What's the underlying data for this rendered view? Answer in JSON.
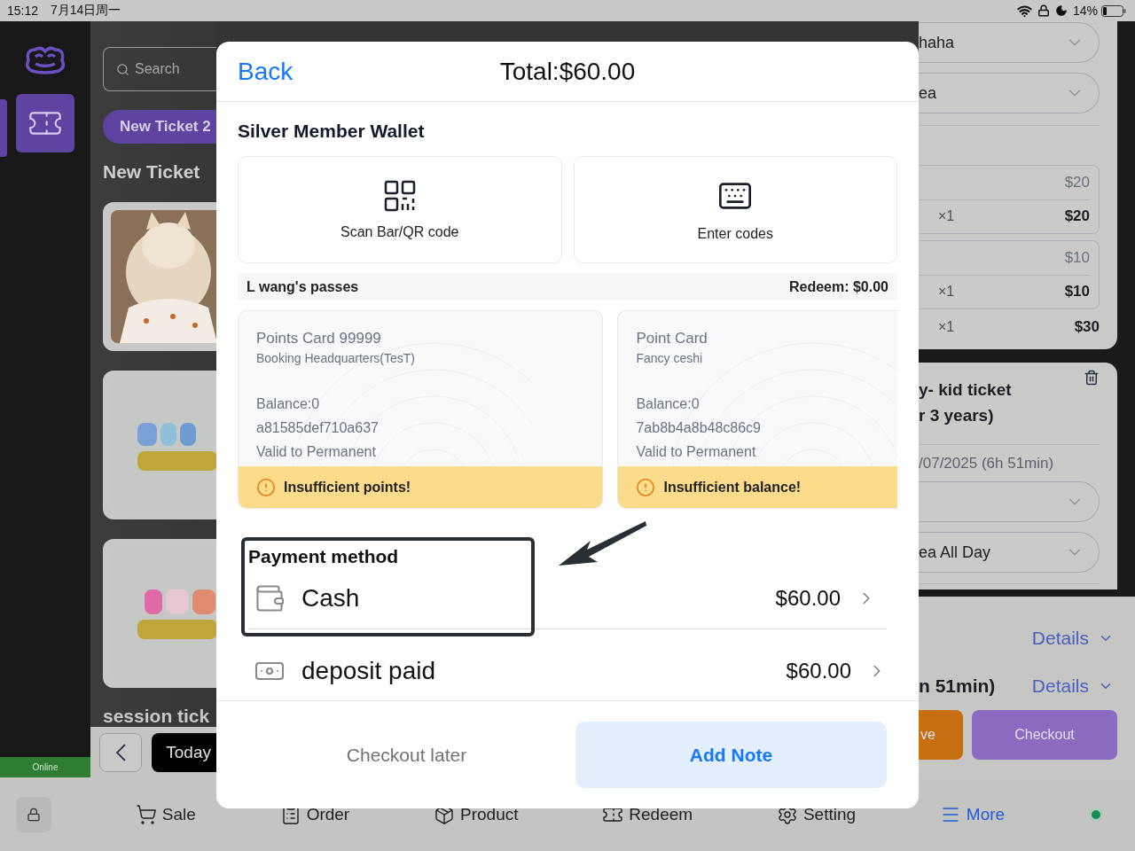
{
  "status_bar": {
    "time": "15:12",
    "date": "7月14日周一",
    "battery": "14%"
  },
  "sidebar": {
    "items": [
      {
        "kind": "ticket",
        "selected": true
      }
    ],
    "connection": "Online"
  },
  "left_panel": {
    "search": {
      "placeholder": "Search"
    },
    "ticket_tab": "New Ticket 2",
    "heading": "New Ticket",
    "section": "session tick",
    "date_button": "Today"
  },
  "right_panel": {
    "fields": [
      {
        "value": "haha"
      },
      {
        "value": "ea"
      }
    ],
    "lines": [
      {
        "unit_price": "$20",
        "qty": "×1",
        "price": "$20"
      },
      {
        "unit_price": "$10",
        "qty": "×1",
        "price": "$10"
      }
    ],
    "total_line": {
      "qty": "×1",
      "price": "$30"
    },
    "ticket": {
      "title_lines": [
        "y- kid ticket",
        "r 3 years)"
      ],
      "time": "/07/2025 (6h 51min)",
      "selects": [
        {
          "kind": "blank"
        },
        {
          "kind": "filled",
          "value": "ea All Day"
        }
      ]
    },
    "summary": [
      {
        "link": "Details"
      },
      {
        "text": "n 51min)",
        "link": "Details"
      }
    ],
    "actions": [
      {
        "kind": "save",
        "label": "ve"
      },
      {
        "kind": "checkout",
        "label": "Checkout"
      }
    ]
  },
  "bottom_nav": [
    {
      "kind": "sale",
      "label": "Sale",
      "selected": false
    },
    {
      "kind": "order",
      "label": "Order",
      "selected": false
    },
    {
      "kind": "product",
      "label": "Product",
      "selected": false
    },
    {
      "kind": "redeem",
      "label": "Redeem",
      "selected": false
    },
    {
      "kind": "setting",
      "label": "Setting",
      "selected": false
    },
    {
      "kind": "more",
      "label": "More",
      "selected": true
    }
  ],
  "modal": {
    "back": "Back",
    "total": "Total:$60.00",
    "wallet_title": "Silver Member Wallet",
    "options": [
      {
        "kind": "scan",
        "label": "Scan Bar/QR code"
      },
      {
        "kind": "codes",
        "label": "Enter codes"
      }
    ],
    "passes": {
      "owner": "L wang's passes",
      "redeem": "Redeem: $0.00"
    },
    "cards": [
      {
        "title": "Points Card 99999",
        "subtitle": "Booking Headquarters(TesT)",
        "balance": "Balance:0",
        "code": "a81585def710a637",
        "validity": "Valid to Permanent",
        "warning": "Insufficient points!"
      },
      {
        "title": "Point Card",
        "subtitle": "Fancy ceshi",
        "balance": "Balance:0",
        "code": "7ab8b4a8b48c86c9",
        "validity": "Valid to Permanent",
        "warning": "Insufficient balance!"
      }
    ],
    "payment": {
      "title": "Payment method",
      "methods": [
        {
          "kind": "cash",
          "label": "Cash",
          "amount": "$60.00"
        },
        {
          "kind": "deposit",
          "label": "deposit paid",
          "amount": "$60.00"
        }
      ]
    },
    "footer": {
      "secondary": "Checkout later",
      "primary": "Add Note"
    }
  }
}
